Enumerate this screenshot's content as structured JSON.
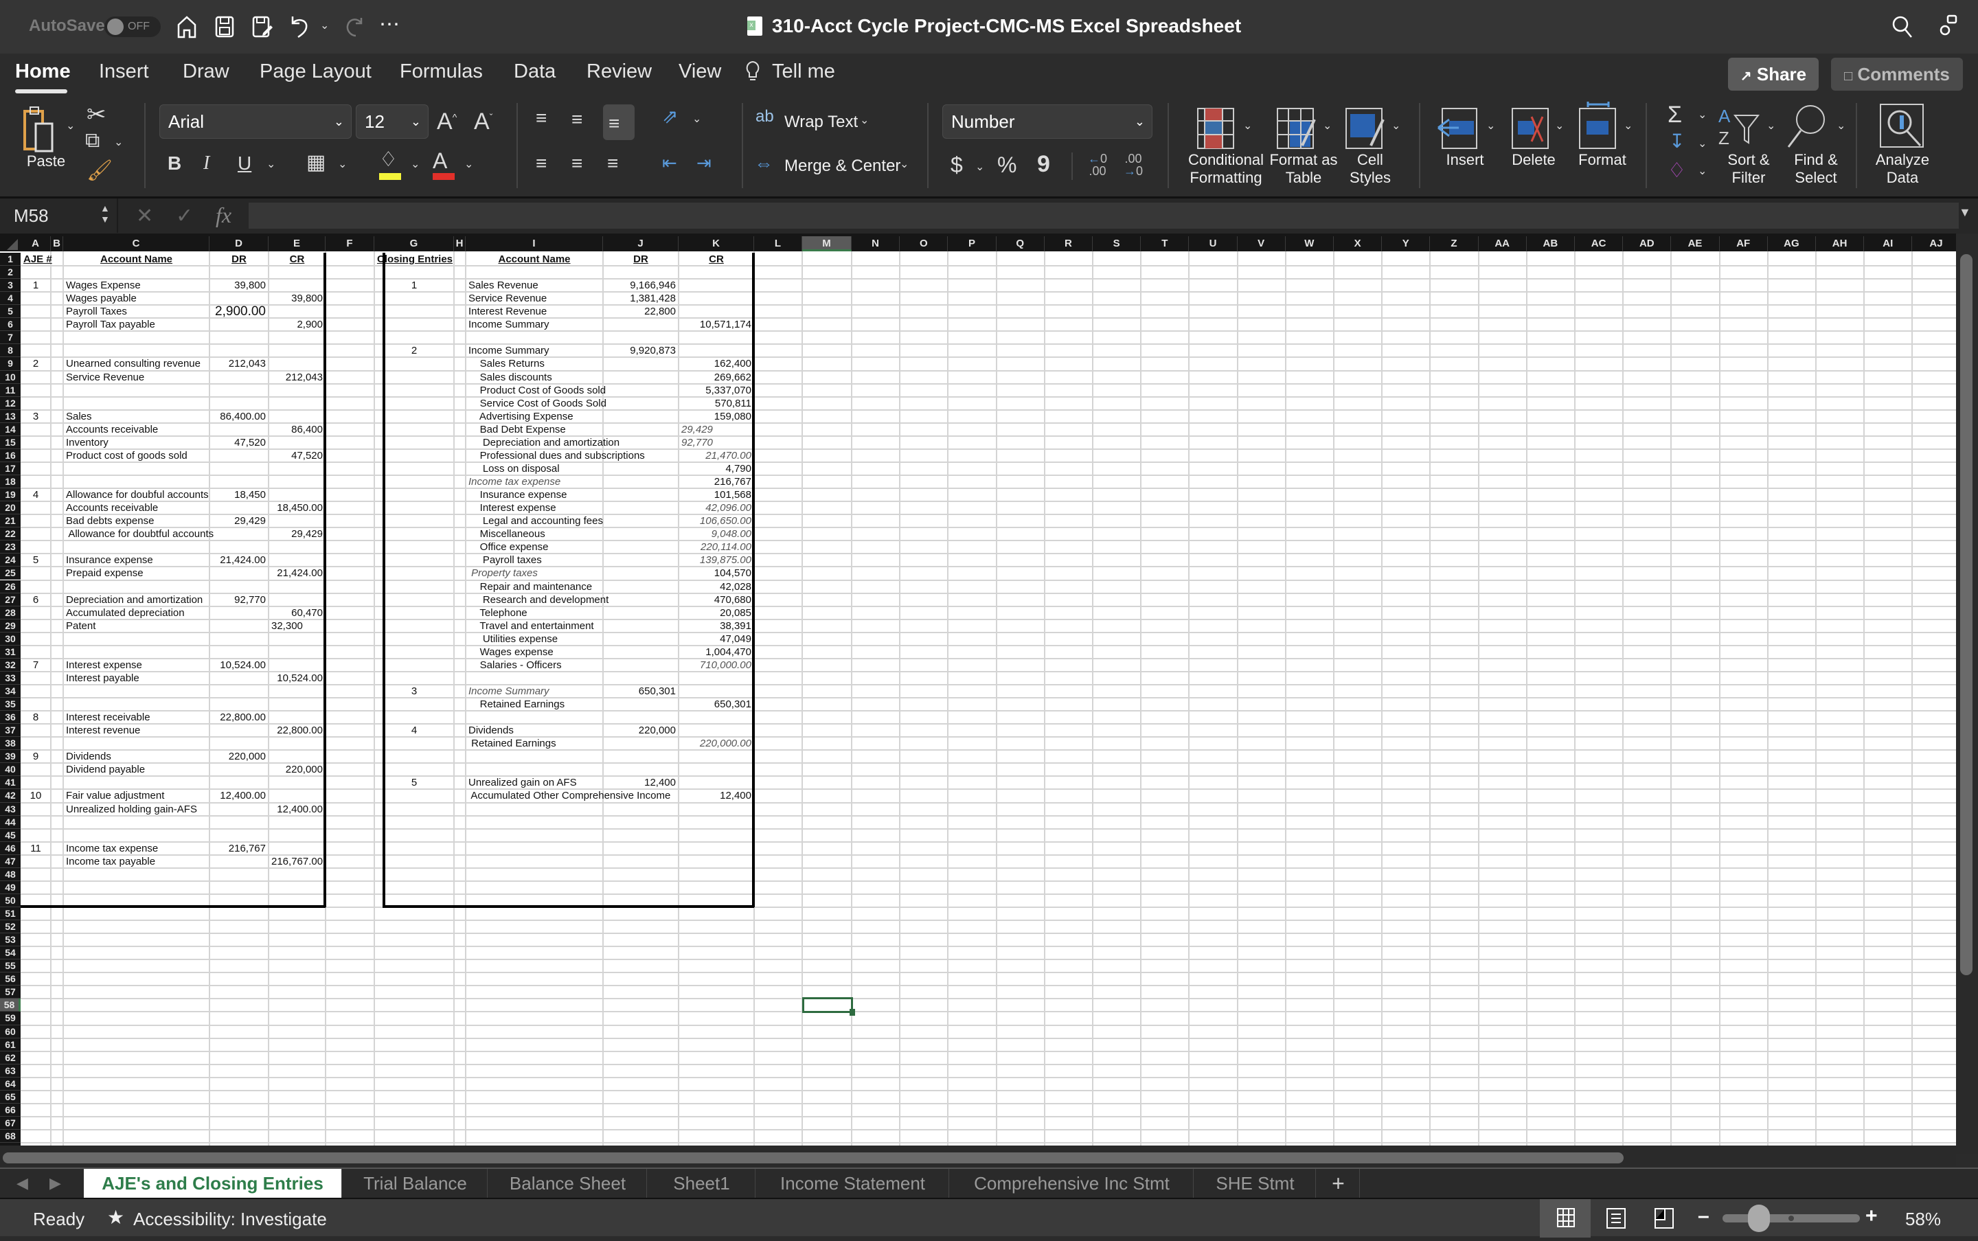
{
  "titlebar": {
    "autosave_label": "AutoSave",
    "autosave_state": "OFF",
    "document_title": "310-Acct Cycle Project-CMC-MS Excel Spreadsheet",
    "more_label": "⋯"
  },
  "ribbon_tabs": [
    {
      "label": "Home",
      "active": true
    },
    {
      "label": "Insert"
    },
    {
      "label": "Draw"
    },
    {
      "label": "Page Layout"
    },
    {
      "label": "Formulas"
    },
    {
      "label": "Data"
    },
    {
      "label": "Review"
    },
    {
      "label": "View"
    },
    {
      "label": "Tell me"
    }
  ],
  "share_label": "Share",
  "comments_label": "Comments",
  "ribbon": {
    "paste_label": "Paste",
    "font_name": "Arial",
    "font_size": "12",
    "bold": "B",
    "italic": "I",
    "underline": "U",
    "wrap_text": "Wrap Text",
    "merge_center": "Merge & Center",
    "number_format": "Number",
    "currency": "$",
    "percent": "%",
    "comma": "9",
    "conditional_formatting": "Conditional Formatting",
    "format_as_table": "Format as Table",
    "cell_styles": "Cell Styles",
    "insert": "Insert",
    "delete": "Delete",
    "format": "Format",
    "sort_filter": "Sort & Filter",
    "find_select": "Find & Select",
    "analyze_data": "Analyze Data",
    "highlight_color": "#f5f53a",
    "font_color": "#e2302a"
  },
  "formula_bar": {
    "name_box": "M58",
    "fx": "fx",
    "formula": ""
  },
  "columns": [
    "A",
    "B",
    "C",
    "D",
    "E",
    "F",
    "G",
    "H",
    "I",
    "J",
    "K",
    "L",
    "M",
    "N",
    "O",
    "P",
    "Q",
    "R",
    "S",
    "T",
    "U",
    "V",
    "W",
    "X",
    "Y",
    "Z",
    "AA",
    "AB",
    "AC",
    "AD",
    "AE",
    "AF",
    "AG",
    "AH",
    "AI",
    "AJ"
  ],
  "selected_cell": {
    "column": "M",
    "row": 58
  },
  "row_count": 69,
  "aje": {
    "headers": {
      "num": "AJE #",
      "account": "Account Name",
      "dr": "DR",
      "cr": "CR"
    },
    "rows": [
      {
        "row": 3,
        "num": "1",
        "account": "Wages Expense",
        "dr": "39,800",
        "cr": ""
      },
      {
        "row": 4,
        "num": "",
        "account": "Wages payable",
        "dr": "",
        "cr": "39,800"
      },
      {
        "row": 5,
        "num": "",
        "account": "Payroll Taxes",
        "dr": "2,900.00",
        "cr": "",
        "style": "big"
      },
      {
        "row": 6,
        "num": "",
        "account": "Payroll Tax payable",
        "dr": "",
        "cr": "2,900"
      },
      {
        "row": 9,
        "num": "2",
        "account": "Unearned consulting revenue",
        "dr": "212,043",
        "cr": ""
      },
      {
        "row": 10,
        "num": "",
        "account": "Service Revenue",
        "dr": "",
        "cr": "212,043"
      },
      {
        "row": 13,
        "num": "3",
        "account": "Sales",
        "dr": "86,400.00",
        "cr": ""
      },
      {
        "row": 14,
        "num": "",
        "account": "Accounts receivable",
        "dr": "",
        "cr": "86,400"
      },
      {
        "row": 15,
        "num": "",
        "account": "Inventory",
        "dr": "47,520",
        "cr": ""
      },
      {
        "row": 16,
        "num": "",
        "account": "Product cost of goods sold",
        "dr": "",
        "cr": "47,520"
      },
      {
        "row": 19,
        "num": "4",
        "account": "Allowance for doubful accounts",
        "dr": "18,450",
        "cr": ""
      },
      {
        "row": 20,
        "num": "",
        "account": "Accounts receivable",
        "dr": "",
        "cr": "18,450.00"
      },
      {
        "row": 21,
        "num": "",
        "account": "Bad debts expense",
        "dr": "29,429",
        "cr": ""
      },
      {
        "row": 22,
        "num": "",
        "account": " Allowance for doubtful accounts",
        "dr": "",
        "cr": "29,429"
      },
      {
        "row": 24,
        "num": "5",
        "account": "Insurance expense",
        "dr": "21,424.00",
        "cr": ""
      },
      {
        "row": 25,
        "num": "",
        "account": "Prepaid expense",
        "dr": "",
        "cr": "21,424.00"
      },
      {
        "row": 27,
        "num": "6",
        "account": "Depreciation and amortization",
        "dr": "92,770",
        "cr": ""
      },
      {
        "row": 28,
        "num": "",
        "account": "Accumulated depreciation",
        "dr": "",
        "cr": "60,470"
      },
      {
        "row": 29,
        "num": "",
        "account": "Patent",
        "dr": "",
        "cr": "32,300",
        "cr_align": "left"
      },
      {
        "row": 32,
        "num": "7",
        "account": "Interest expense",
        "dr": "10,524.00",
        "cr": ""
      },
      {
        "row": 33,
        "num": "",
        "account": "Interest payable",
        "dr": "",
        "cr": "10,524.00"
      },
      {
        "row": 36,
        "num": "8",
        "account": "Interest receivable",
        "dr": "22,800.00",
        "cr": ""
      },
      {
        "row": 37,
        "num": "",
        "account": "Interest revenue",
        "dr": "",
        "cr": "22,800.00"
      },
      {
        "row": 39,
        "num": "9",
        "account": "Dividends",
        "dr": "220,000",
        "cr": ""
      },
      {
        "row": 40,
        "num": "",
        "account": "Dividend payable",
        "dr": "",
        "cr": "220,000"
      },
      {
        "row": 42,
        "num": "10",
        "account": "Fair value adjustment",
        "dr": "12,400.00",
        "cr": ""
      },
      {
        "row": 43,
        "num": "",
        "account": "Unrealized holding gain-AFS",
        "dr": "",
        "cr": "12,400.00"
      },
      {
        "row": 46,
        "num": "11",
        "account": "Income tax expense",
        "dr": "216,767",
        "cr": ""
      },
      {
        "row": 47,
        "num": "",
        "account": "Income tax payable",
        "dr": "",
        "cr": "216,767.00"
      }
    ]
  },
  "closing": {
    "headers": {
      "num": "Closing Entries",
      "account": "Account Name",
      "dr": "DR",
      "cr": "CR"
    },
    "rows": [
      {
        "row": 3,
        "num": "1",
        "account": "Sales Revenue",
        "dr": "9,166,946",
        "cr": ""
      },
      {
        "row": 4,
        "num": "",
        "account": "Service Revenue",
        "dr": "1,381,428",
        "cr": ""
      },
      {
        "row": 5,
        "num": "",
        "account": "Interest Revenue",
        "dr": "22,800",
        "cr": ""
      },
      {
        "row": 6,
        "num": "",
        "account": "Income Summary",
        "dr": "",
        "cr": "10,571,174"
      },
      {
        "row": 8,
        "num": "2",
        "account": "Income Summary",
        "dr": "9,920,873",
        "cr": ""
      },
      {
        "row": 9,
        "num": "",
        "account": "    Sales Returns",
        "dr": "",
        "cr": "162,400"
      },
      {
        "row": 10,
        "num": "",
        "account": "    Sales discounts",
        "dr": "",
        "cr": "269,662"
      },
      {
        "row": 11,
        "num": "",
        "account": "    Product Cost of Goods sold",
        "dr": "",
        "cr": "5,337,070"
      },
      {
        "row": 12,
        "num": "",
        "account": "    Service Cost of Goods Sold",
        "dr": "",
        "cr": "570,811"
      },
      {
        "row": 13,
        "num": "",
        "account": "    Advertising Expense",
        "dr": "",
        "cr": "159,080"
      },
      {
        "row": 14,
        "num": "",
        "account": "    Bad Debt Expense",
        "dr": "",
        "cr": "29,429",
        "cr_style": "it",
        "cr_align": "left"
      },
      {
        "row": 15,
        "num": "",
        "account": "     Depreciation and amortization",
        "dr": "",
        "cr": "92,770",
        "cr_style": "it",
        "cr_align": "left"
      },
      {
        "row": 16,
        "num": "",
        "account": "    Professional dues and subscriptions",
        "dr": "",
        "cr": "21,470.00",
        "cr_style": "it"
      },
      {
        "row": 17,
        "num": "",
        "account": "     Loss on disposal",
        "dr": "",
        "cr": "4,790"
      },
      {
        "row": 18,
        "num": "",
        "account": "Income tax expense",
        "dr": "",
        "cr": "216,767",
        "acct_style": "it"
      },
      {
        "row": 19,
        "num": "",
        "account": "    Insurance expense",
        "dr": "",
        "cr": "101,568"
      },
      {
        "row": 20,
        "num": "",
        "account": "    Interest expense",
        "dr": "",
        "cr": "42,096.00",
        "cr_style": "it"
      },
      {
        "row": 21,
        "num": "",
        "account": "     Legal and accounting fees",
        "dr": "",
        "cr": "106,650.00",
        "cr_style": "it"
      },
      {
        "row": 22,
        "num": "",
        "account": "    Miscellaneous",
        "dr": "",
        "cr": "9,048.00",
        "cr_style": "it"
      },
      {
        "row": 23,
        "num": "",
        "account": "    Office expense",
        "dr": "",
        "cr": "220,114.00",
        "cr_style": "it"
      },
      {
        "row": 24,
        "num": "",
        "account": "     Payroll taxes",
        "dr": "",
        "cr": "139,875.00",
        "cr_style": "it"
      },
      {
        "row": 25,
        "num": "",
        "account": " Property taxes",
        "dr": "",
        "cr": "104,570",
        "acct_style": "it"
      },
      {
        "row": 26,
        "num": "",
        "account": "    Repair and maintenance",
        "dr": "",
        "cr": "42,028"
      },
      {
        "row": 27,
        "num": "",
        "account": "     Research and development",
        "dr": "",
        "cr": "470,680"
      },
      {
        "row": 28,
        "num": "",
        "account": "    Telephone",
        "dr": "",
        "cr": "20,085"
      },
      {
        "row": 29,
        "num": "",
        "account": "    Travel and entertainment",
        "dr": "",
        "cr": "38,391"
      },
      {
        "row": 30,
        "num": "",
        "account": "     Utilities expense",
        "dr": "",
        "cr": "47,049"
      },
      {
        "row": 31,
        "num": "",
        "account": "    Wages expense",
        "dr": "",
        "cr": "1,004,470"
      },
      {
        "row": 32,
        "num": "",
        "account": "    Salaries - Officers",
        "dr": "",
        "cr": "710,000.00",
        "cr_style": "it"
      },
      {
        "row": 34,
        "num": "3",
        "account": "Income Summary",
        "dr": "650,301",
        "cr": "",
        "acct_style": "it"
      },
      {
        "row": 35,
        "num": "",
        "account": "    Retained Earnings",
        "dr": "",
        "cr": "650,301"
      },
      {
        "row": 37,
        "num": "4",
        "account": "Dividends",
        "dr": "220,000",
        "cr": ""
      },
      {
        "row": 38,
        "num": "",
        "account": " Retained Earnings",
        "dr": "",
        "cr": "220,000.00",
        "cr_style": "it"
      },
      {
        "row": 41,
        "num": "5",
        "account": "Unrealized gain on AFS",
        "dr": "12,400",
        "cr": ""
      },
      {
        "row": 42,
        "num": "",
        "account": " Accumulated Other Comprehensive Income",
        "dr": "",
        "cr": "12,400"
      }
    ]
  },
  "sheet_tabs": [
    {
      "label": "AJE's and Closing Entries",
      "active": true
    },
    {
      "label": "Trial Balance"
    },
    {
      "label": "Balance Sheet"
    },
    {
      "label": "Sheet1"
    },
    {
      "label": "Income Statement"
    },
    {
      "label": "Comprehensive Inc Stmt"
    },
    {
      "label": "SHE Stmt"
    }
  ],
  "add_sheet_label": "+",
  "status": {
    "ready": "Ready",
    "accessibility": "Accessibility: Investigate",
    "zoom_level": "58%",
    "zoom_fraction": 0.58
  }
}
